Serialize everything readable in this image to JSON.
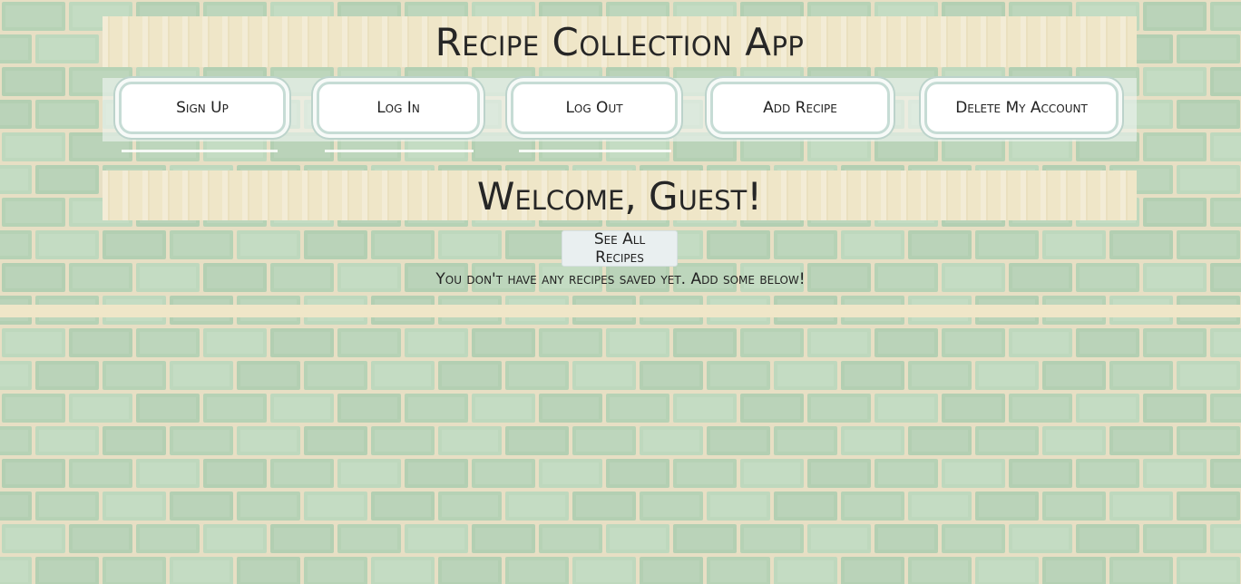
{
  "app": {
    "title": "Recipe Collection App"
  },
  "nav": {
    "items": [
      {
        "label": "Sign Up"
      },
      {
        "label": "Log In"
      },
      {
        "label": "Log Out"
      },
      {
        "label": "Add Recipe"
      },
      {
        "label": "Delete My Account"
      }
    ]
  },
  "main": {
    "welcome": "Welcome, Guest!",
    "see_all_label": "See All Recipes",
    "empty_message": "You don't have any recipes saved yet. Add some below!"
  },
  "colors": {
    "tile_green": "#b9d4b8",
    "grout": "#e7dfc4",
    "banner": "#efe6c8",
    "button_border": "#c6dcd5"
  }
}
